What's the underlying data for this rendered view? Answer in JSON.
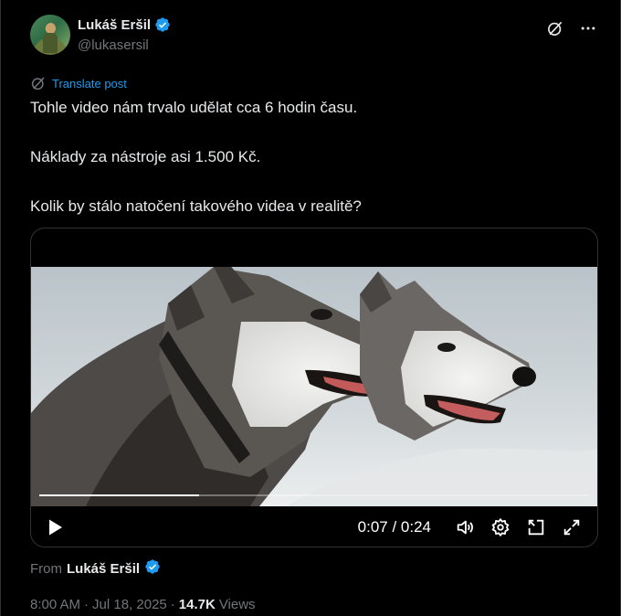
{
  "author": {
    "name": "Lukáš Eršil",
    "handle": "@lukasersil",
    "verified": true
  },
  "icons": {
    "verified": "verified-badge-icon",
    "grok": "grok-icon",
    "more": "more-icon",
    "translate": "translate-icon",
    "play": "play-icon",
    "volume": "volume-icon",
    "settings": "settings-icon",
    "pip": "picture-in-picture-icon",
    "fullscreen": "fullscreen-icon"
  },
  "colors": {
    "accent": "#1d9bf0",
    "text": "#e7e9ea",
    "muted": "#71767b",
    "background": "#000000"
  },
  "post": {
    "translate_label": "Translate post",
    "paragraphs": [
      "Tohle video nám trvalo udělat cca 6 hodin času.",
      "Náklady za nástroje asi 1.500 Kč.",
      "Kolik by stálo natočení takového videa v realitě?"
    ]
  },
  "video": {
    "current_time": "0:07",
    "duration": "0:24",
    "time_display": "0:07 / 0:24",
    "progress": 0.29
  },
  "from": {
    "label": "From",
    "name": "Lukáš Eršil"
  },
  "meta": {
    "time": "8:00 AM",
    "date": "Jul 18, 2025",
    "views_count": "14.7K",
    "views_label": "Views"
  }
}
